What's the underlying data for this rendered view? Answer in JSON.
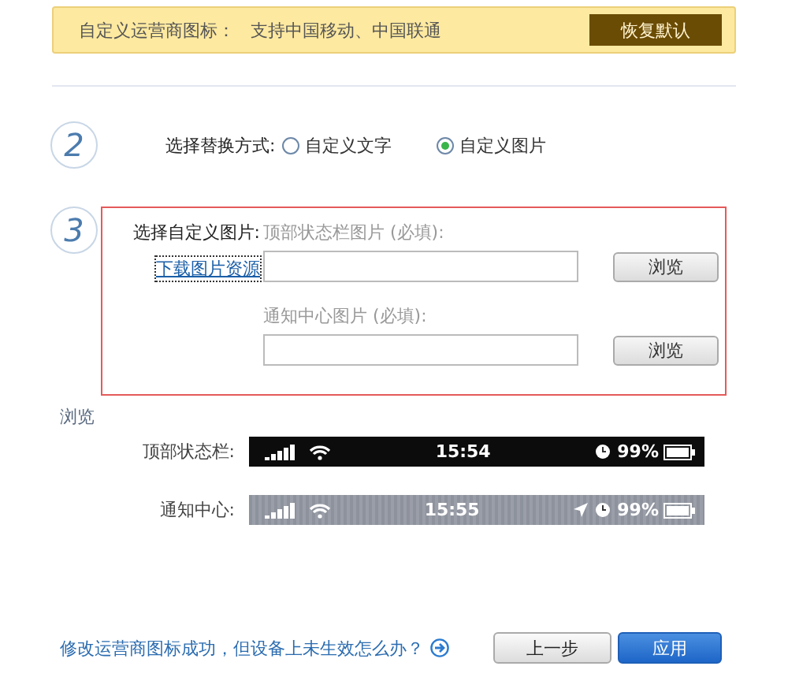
{
  "notice": {
    "label": "自定义运营商图标：",
    "text": "支持中国移动、中国联通",
    "button": "恢复默认"
  },
  "step2": {
    "number": "2",
    "label": "选择替换方式:",
    "options": [
      {
        "label": "自定义文字",
        "selected": false
      },
      {
        "label": "自定义图片",
        "selected": true
      }
    ]
  },
  "step3": {
    "number": "3",
    "label": "选择自定义图片:",
    "link": "下载图片资源",
    "fields": [
      {
        "label": "顶部状态栏图片 (必填):",
        "button": "浏览"
      },
      {
        "label": "通知中心图片 (必填):",
        "button": "浏览"
      }
    ]
  },
  "preview": {
    "title": "浏览",
    "rows": [
      {
        "label": "顶部状态栏:",
        "kind": "dark",
        "time": "15:54",
        "battery": "99%",
        "location": false
      },
      {
        "label": "通知中心:",
        "kind": "light",
        "time": "15:55",
        "battery": "99%",
        "location": true
      }
    ]
  },
  "footer": {
    "link": "修改运营商图标成功，但设备上未生效怎么办？",
    "buttons": [
      {
        "label": "上一步",
        "kind": "secondary"
      },
      {
        "label": "应用",
        "kind": "primary"
      }
    ]
  }
}
